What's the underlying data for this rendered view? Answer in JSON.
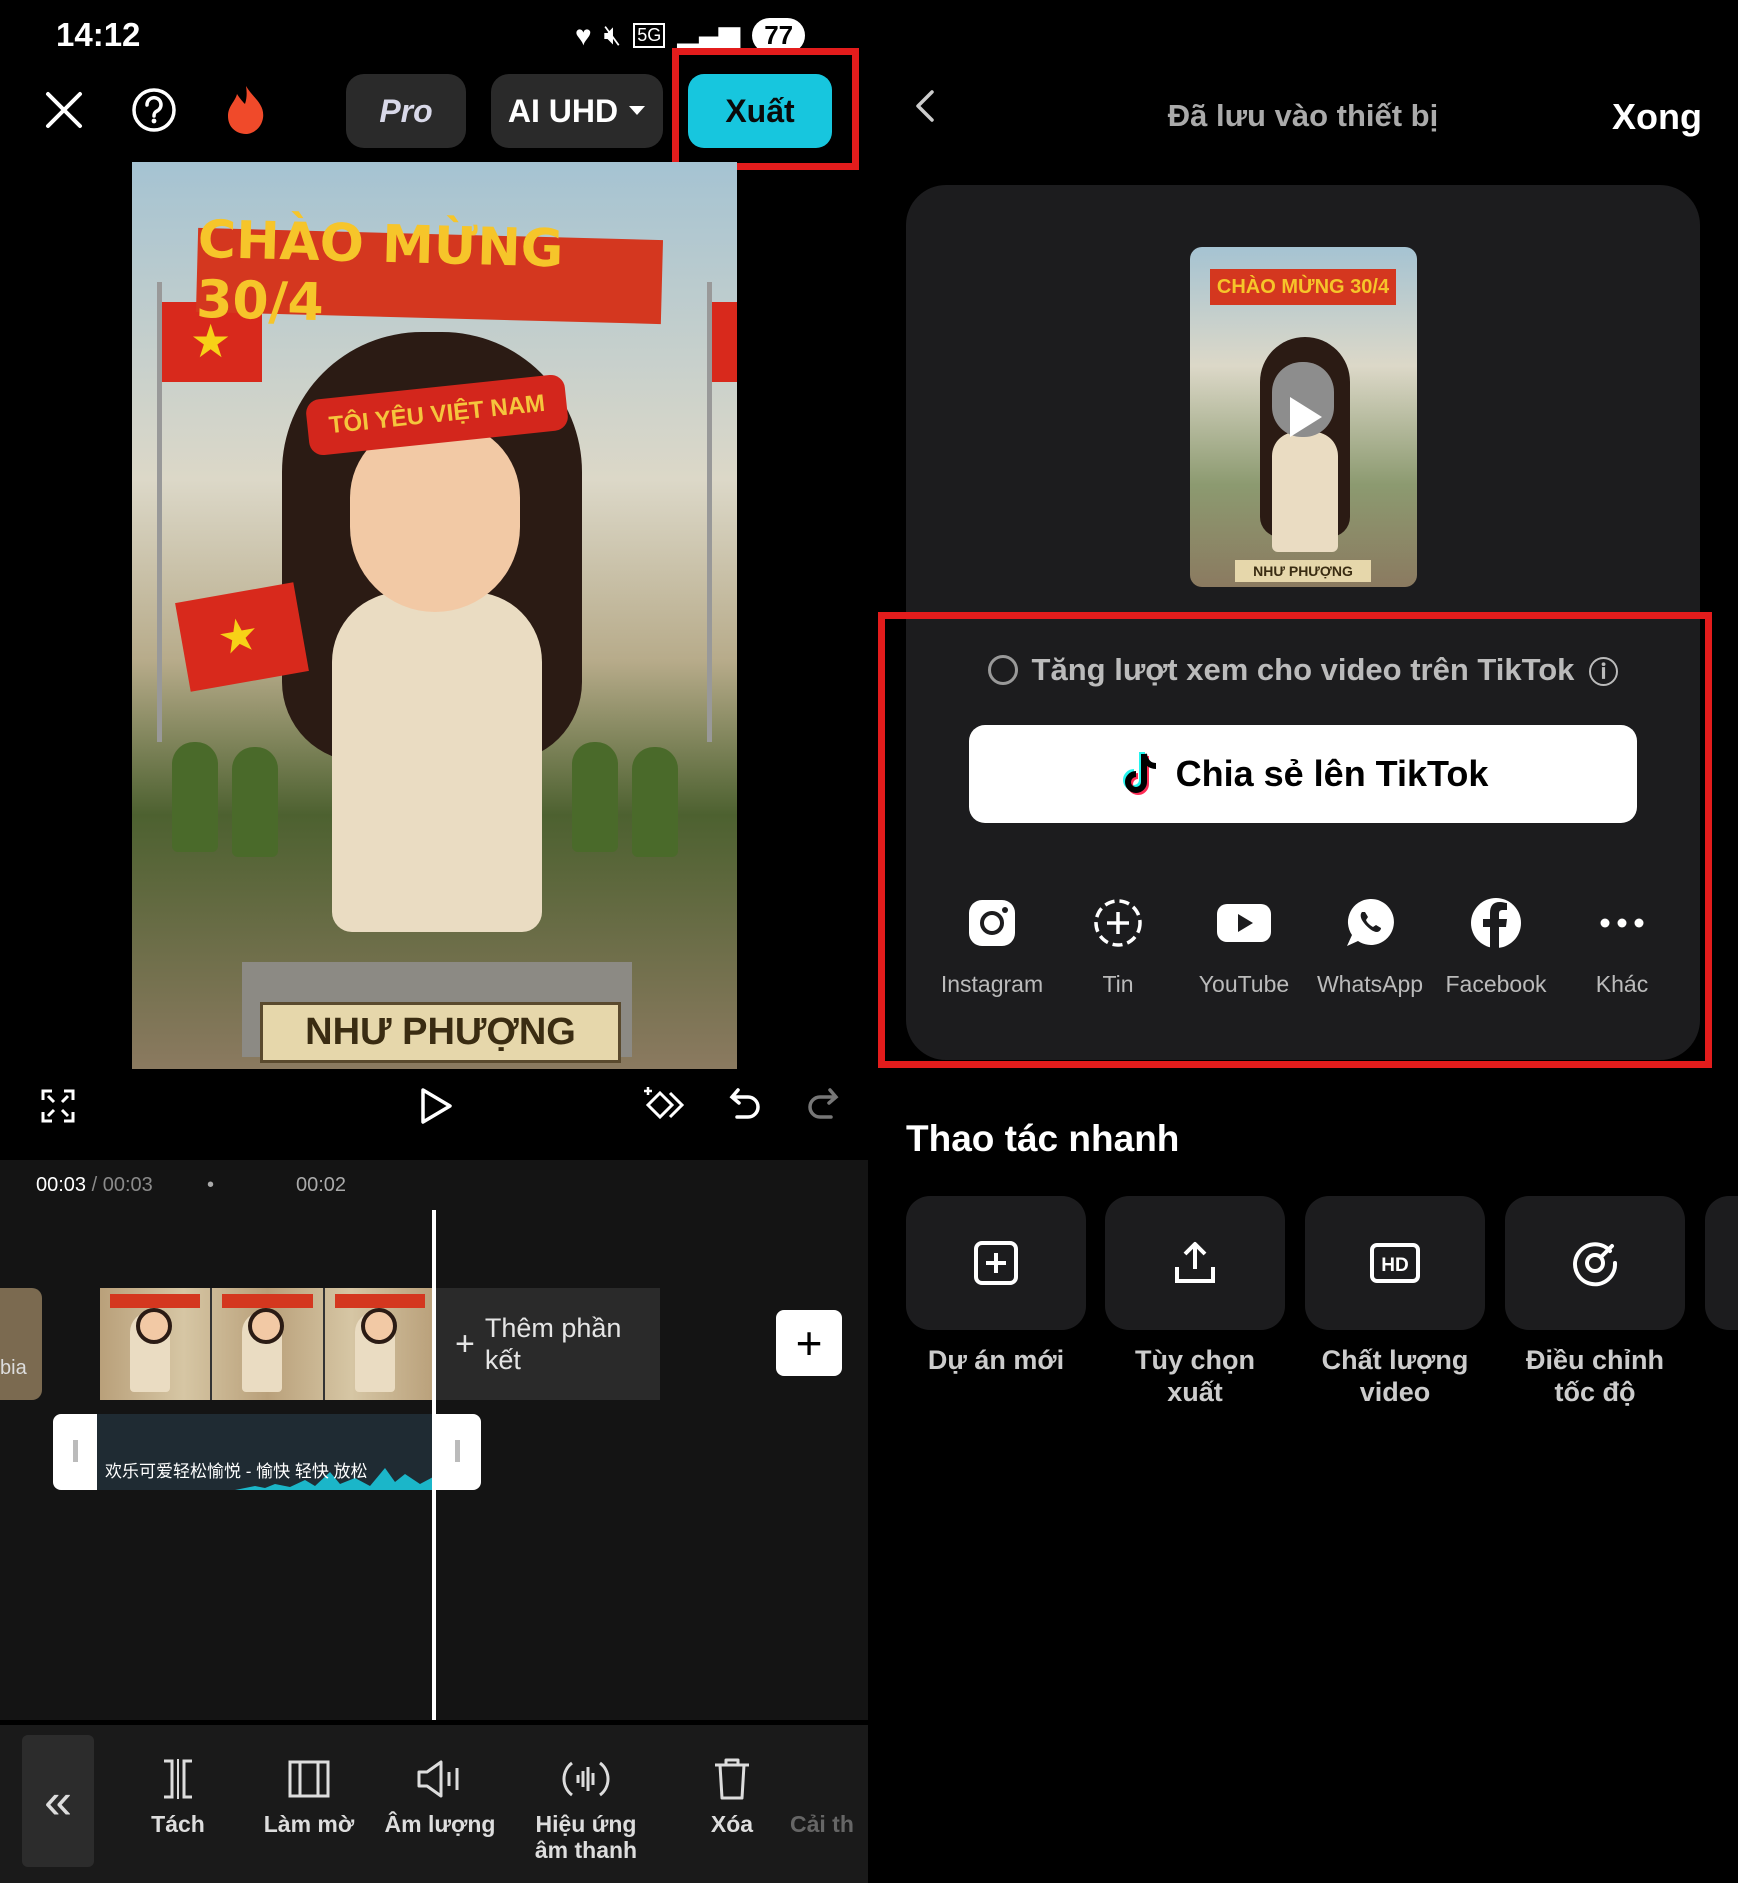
{
  "status_bar": {
    "time": "14:12",
    "network": "5G",
    "battery": "77"
  },
  "editor": {
    "pro_label": "Pro",
    "quality_label": "AI UHD",
    "export_label": "Xuất",
    "preview": {
      "banner_text": "CHÀO MỪNG 30/4",
      "headband_text": "TÔI YÊU VIỆT NAM",
      "nameplate_text": "NHƯ PHƯỢNG"
    },
    "timeline": {
      "current_time": "00:03",
      "total_time": "/ 00:03",
      "tick_dot": "•",
      "tick_label": "00:02",
      "left_clip_label": "bia",
      "add_end_plus": "+",
      "add_end_label": "Thêm phần kết",
      "add_button": "+",
      "audio_label": "欢乐可爱轻松愉悦 - 愉快 轻快 放松"
    },
    "toolbar": {
      "back": "«",
      "items": [
        {
          "label": "Tách",
          "icon": "split-icon"
        },
        {
          "label": "Làm mờ",
          "icon": "fade-icon"
        },
        {
          "label": "Âm lượng",
          "icon": "volume-icon"
        },
        {
          "label": "Hiệu ứng âm thanh",
          "icon": "sound-effect-icon"
        },
        {
          "label": "Xóa",
          "icon": "trash-icon"
        },
        {
          "label": "Cải th",
          "icon": ""
        }
      ]
    }
  },
  "export_panel": {
    "title": "Đã lưu vào thiết bị",
    "done_label": "Xong",
    "thumb": {
      "banner_text": "CHÀO MỪNG 30/4",
      "nameplate_text": "NHƯ PHƯỢNG"
    },
    "boost_label": "Tăng lượt xem cho video trên TikTok",
    "info_glyph": "ⓘ",
    "tiktok_button": "Chia sẻ lên TikTok",
    "share_targets": [
      {
        "label": "Instagram",
        "icon": "instagram-icon"
      },
      {
        "label": "Tin",
        "icon": "story-icon"
      },
      {
        "label": "YouTube",
        "icon": "youtube-icon"
      },
      {
        "label": "WhatsApp",
        "icon": "whatsapp-icon"
      },
      {
        "label": "Facebook",
        "icon": "facebook-icon"
      },
      {
        "label": "Khác",
        "icon": "more-icon"
      }
    ],
    "quick_actions_title": "Thao tác nhanh",
    "quick_actions": [
      {
        "label": "Dự án mới",
        "icon": "new-project-icon"
      },
      {
        "label": "Tùy chọn xuất",
        "icon": "export-options-icon"
      },
      {
        "label": "Chất lượng video",
        "icon": "hd-icon"
      },
      {
        "label": "Điều chỉnh tốc độ",
        "icon": "speed-icon"
      }
    ]
  },
  "colors": {
    "accent": "#17c6de",
    "highlight_box": "#e31c1c",
    "background": "#000000",
    "card": "#1c1c1e"
  }
}
